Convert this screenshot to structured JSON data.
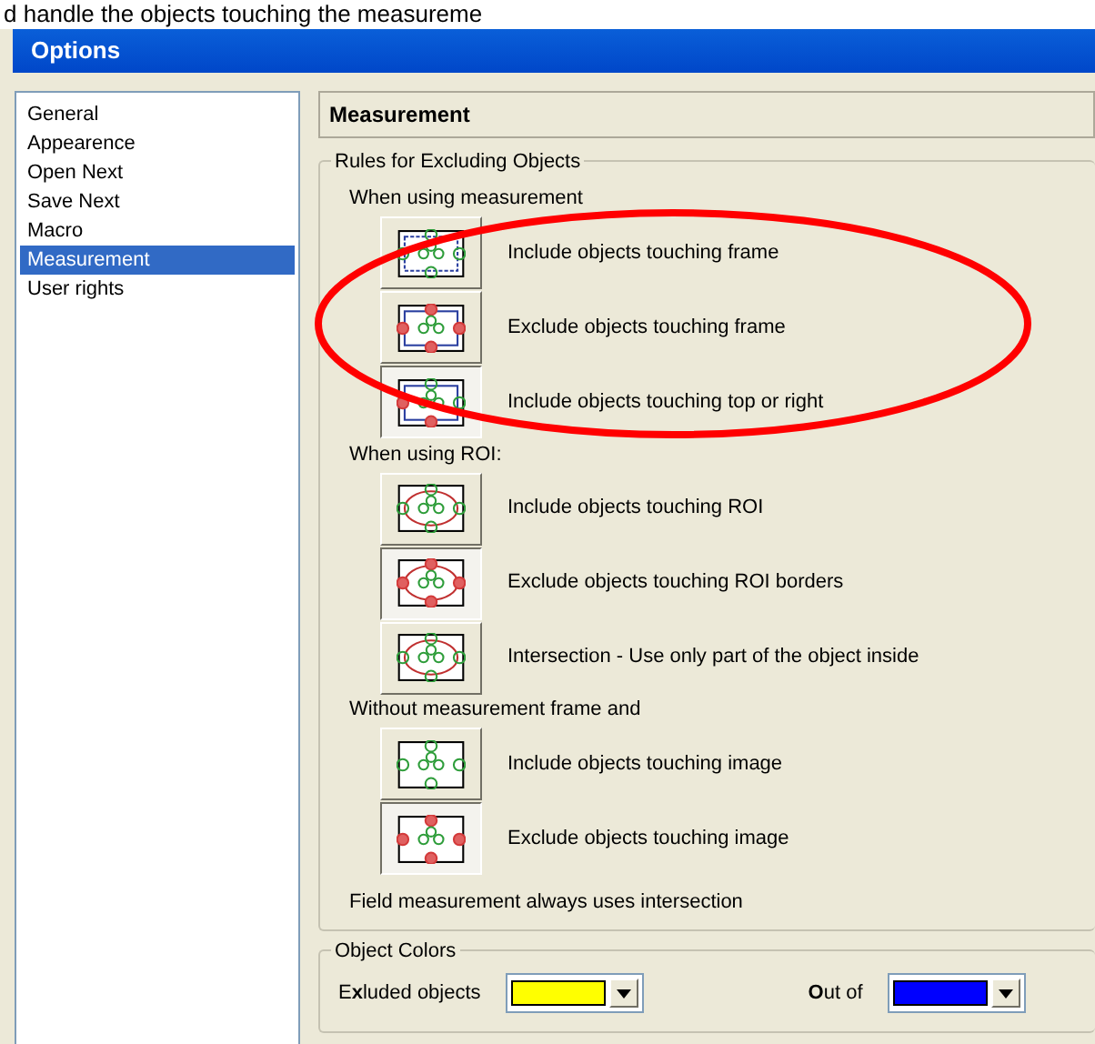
{
  "caption": "d handle the objects touching the measureme",
  "window": {
    "title": "Options"
  },
  "sidebar": {
    "items": [
      {
        "label": "General",
        "selected": false
      },
      {
        "label": "Appearence",
        "selected": false
      },
      {
        "label": "Open Next",
        "selected": false
      },
      {
        "label": "Save Next",
        "selected": false
      },
      {
        "label": "Macro",
        "selected": false
      },
      {
        "label": "Measurement",
        "selected": true
      },
      {
        "label": "User rights",
        "selected": false
      }
    ]
  },
  "page_title": "Measurement",
  "rules_group": {
    "title": "Rules for Excluding Objects",
    "sections": [
      {
        "heading": "When using measurement",
        "options": [
          {
            "kind": "frame-include",
            "label": "Include objects touching frame",
            "selected": false
          },
          {
            "kind": "frame-exclude",
            "label": "Exclude objects touching frame",
            "selected": false
          },
          {
            "kind": "frame-topright",
            "label": "Include objects touching top or right",
            "selected": true
          }
        ]
      },
      {
        "heading": "When using ROI:",
        "options": [
          {
            "kind": "roi-include",
            "label": "Include objects touching ROI",
            "selected": false
          },
          {
            "kind": "roi-exclude",
            "label": "Exclude objects touching ROI borders",
            "selected": true
          },
          {
            "kind": "roi-intersect",
            "label": "Intersection - Use only part of the object inside",
            "selected": false
          }
        ]
      },
      {
        "heading": "Without measurement frame and",
        "options": [
          {
            "kind": "image-include",
            "label": "Include objects touching image",
            "selected": false
          },
          {
            "kind": "image-exclude",
            "label": "Exclude objects touching image",
            "selected": true
          }
        ]
      }
    ],
    "note": "Field measurement always uses intersection"
  },
  "colors_group": {
    "title": "Object Colors",
    "pickers": [
      {
        "label": "E**x**luded objects",
        "color": "#ffff00"
      },
      {
        "label": "**O**ut of",
        "color": "#0000ff"
      }
    ]
  }
}
